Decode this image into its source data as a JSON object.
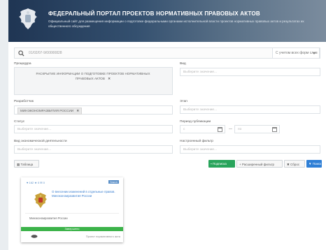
{
  "header": {
    "title": "ФЕДЕРАЛЬНЫЙ ПОРТАЛ ПРОЕКТОВ НОРМАТИВНЫХ ПРАВОВЫХ АКТОВ",
    "subtitle": "Официальный сайт для размещения информации о подготовке федеральными органами исполнительной власти проектов нормативных правовых актов и результатах их общественного обсуждения"
  },
  "search": {
    "value": "01/02/07-9/00000828",
    "scope": "С учетом всех форм слов"
  },
  "filters": {
    "procedure": {
      "label": "Процедура",
      "tag": "РАСКРЫТИЕ ИНФОРМАЦИИ О ПОДГОТОВКЕ ПРОЕКТОВ НОРМАТИВНЫХ ПРАВОВЫХ АКТОВ"
    },
    "kind": {
      "label": "Вид",
      "placeholder": "Выберите значение..."
    },
    "developer": {
      "label": "Разработчик",
      "tag": "МИНЭКОНОМРАЗВИТИЯ РОССИИ"
    },
    "stage": {
      "label": "Этап",
      "placeholder": "Выберите значение..."
    },
    "status": {
      "label": "Статус",
      "placeholder": "Выберите значение..."
    },
    "period": {
      "label": "Период публикации",
      "from": "с",
      "to": "по",
      "dash": "—"
    },
    "economic": {
      "label": "Вид экономической деятельности",
      "placeholder": "Выберите значение..."
    },
    "custom": {
      "label": "Настроенный фильтр",
      "placeholder": "Выберите значение..."
    }
  },
  "actions": {
    "table": "Таблица",
    "subscribe": "Подписка",
    "extended": "Расширенный фильтр",
    "reset": "Сброс",
    "search": "Поиск"
  },
  "card": {
    "stats": "♥ 162   ★ 0   ✉ 0",
    "kind": "Закон",
    "title": "О внесении изменений в отдельные правов. Минэкономразвития России",
    "developer": "Минэкономразвития России",
    "status": "Завершено",
    "footer": "Проект нормативного акта"
  },
  "colors": {
    "header_start": "#1f3553",
    "subscribe": "#28a45b",
    "search": "#2f7fd6",
    "status_done": "#3cb34a",
    "link": "#3a7fd0"
  }
}
